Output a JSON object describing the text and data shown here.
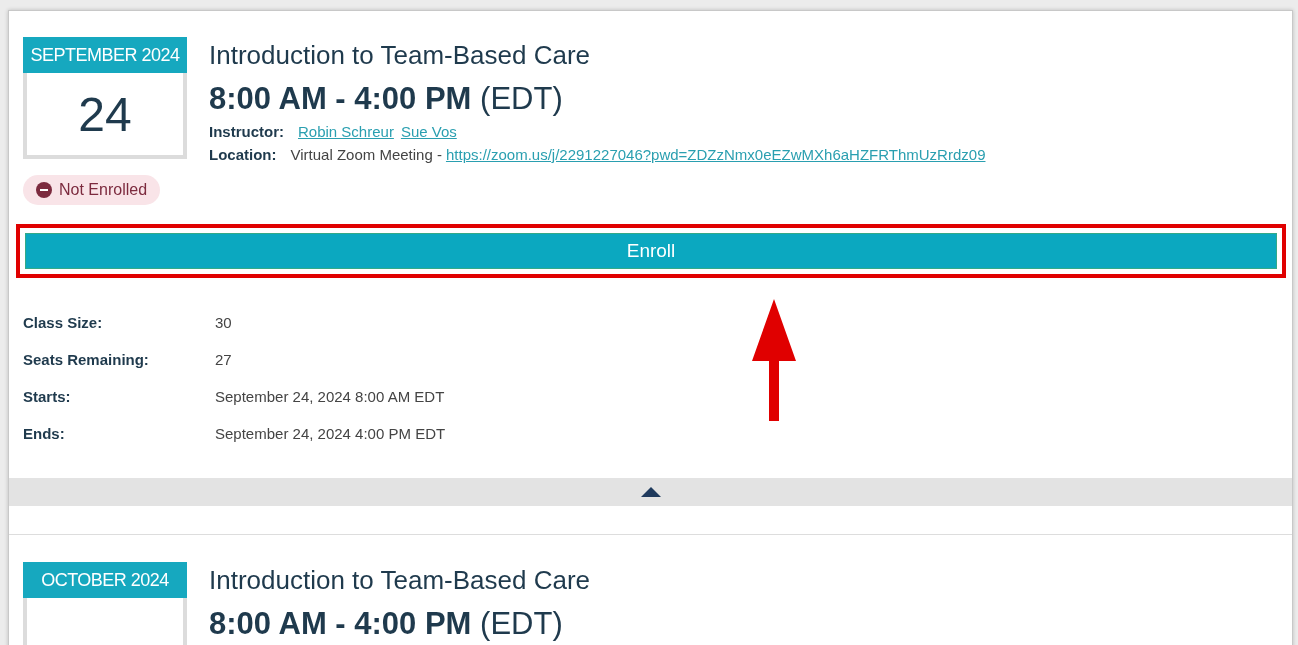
{
  "events": [
    {
      "month": "SEPTEMBER 2024",
      "day": "24",
      "title": "Introduction to Team-Based Care",
      "time": "8:00 AM - 4:00 PM",
      "timezone": "(EDT)",
      "instructor_label": "Instructor:",
      "instructors": [
        "Robin Schreur",
        "Sue Vos"
      ],
      "location_label": "Location:",
      "location": "Virtual Zoom Meeting -",
      "location_link": "https://zoom.us/j/2291227046?pwd=ZDZzNmx0eEZwMXh6aHZFRThmUzRrdz09",
      "status": {
        "label": "Not Enrolled",
        "enrolled": false
      },
      "enroll_button": {
        "label": "Enroll",
        "highlighted": true,
        "arrow": true
      },
      "details": [
        {
          "label": "Class Size:",
          "value": "30"
        },
        {
          "label": "Seats Remaining:",
          "value": "27"
        },
        {
          "label": "Starts:",
          "value": "September 24, 2024 8:00 AM EDT"
        },
        {
          "label": "Ends:",
          "value": "September 24, 2024 4:00 PM EDT"
        }
      ],
      "expanded": true
    },
    {
      "month": "OCTOBER 2024",
      "title": "Introduction to Team-Based Care",
      "time": "8:00 AM - 4:00 PM",
      "timezone": "(EDT)"
    }
  ]
}
